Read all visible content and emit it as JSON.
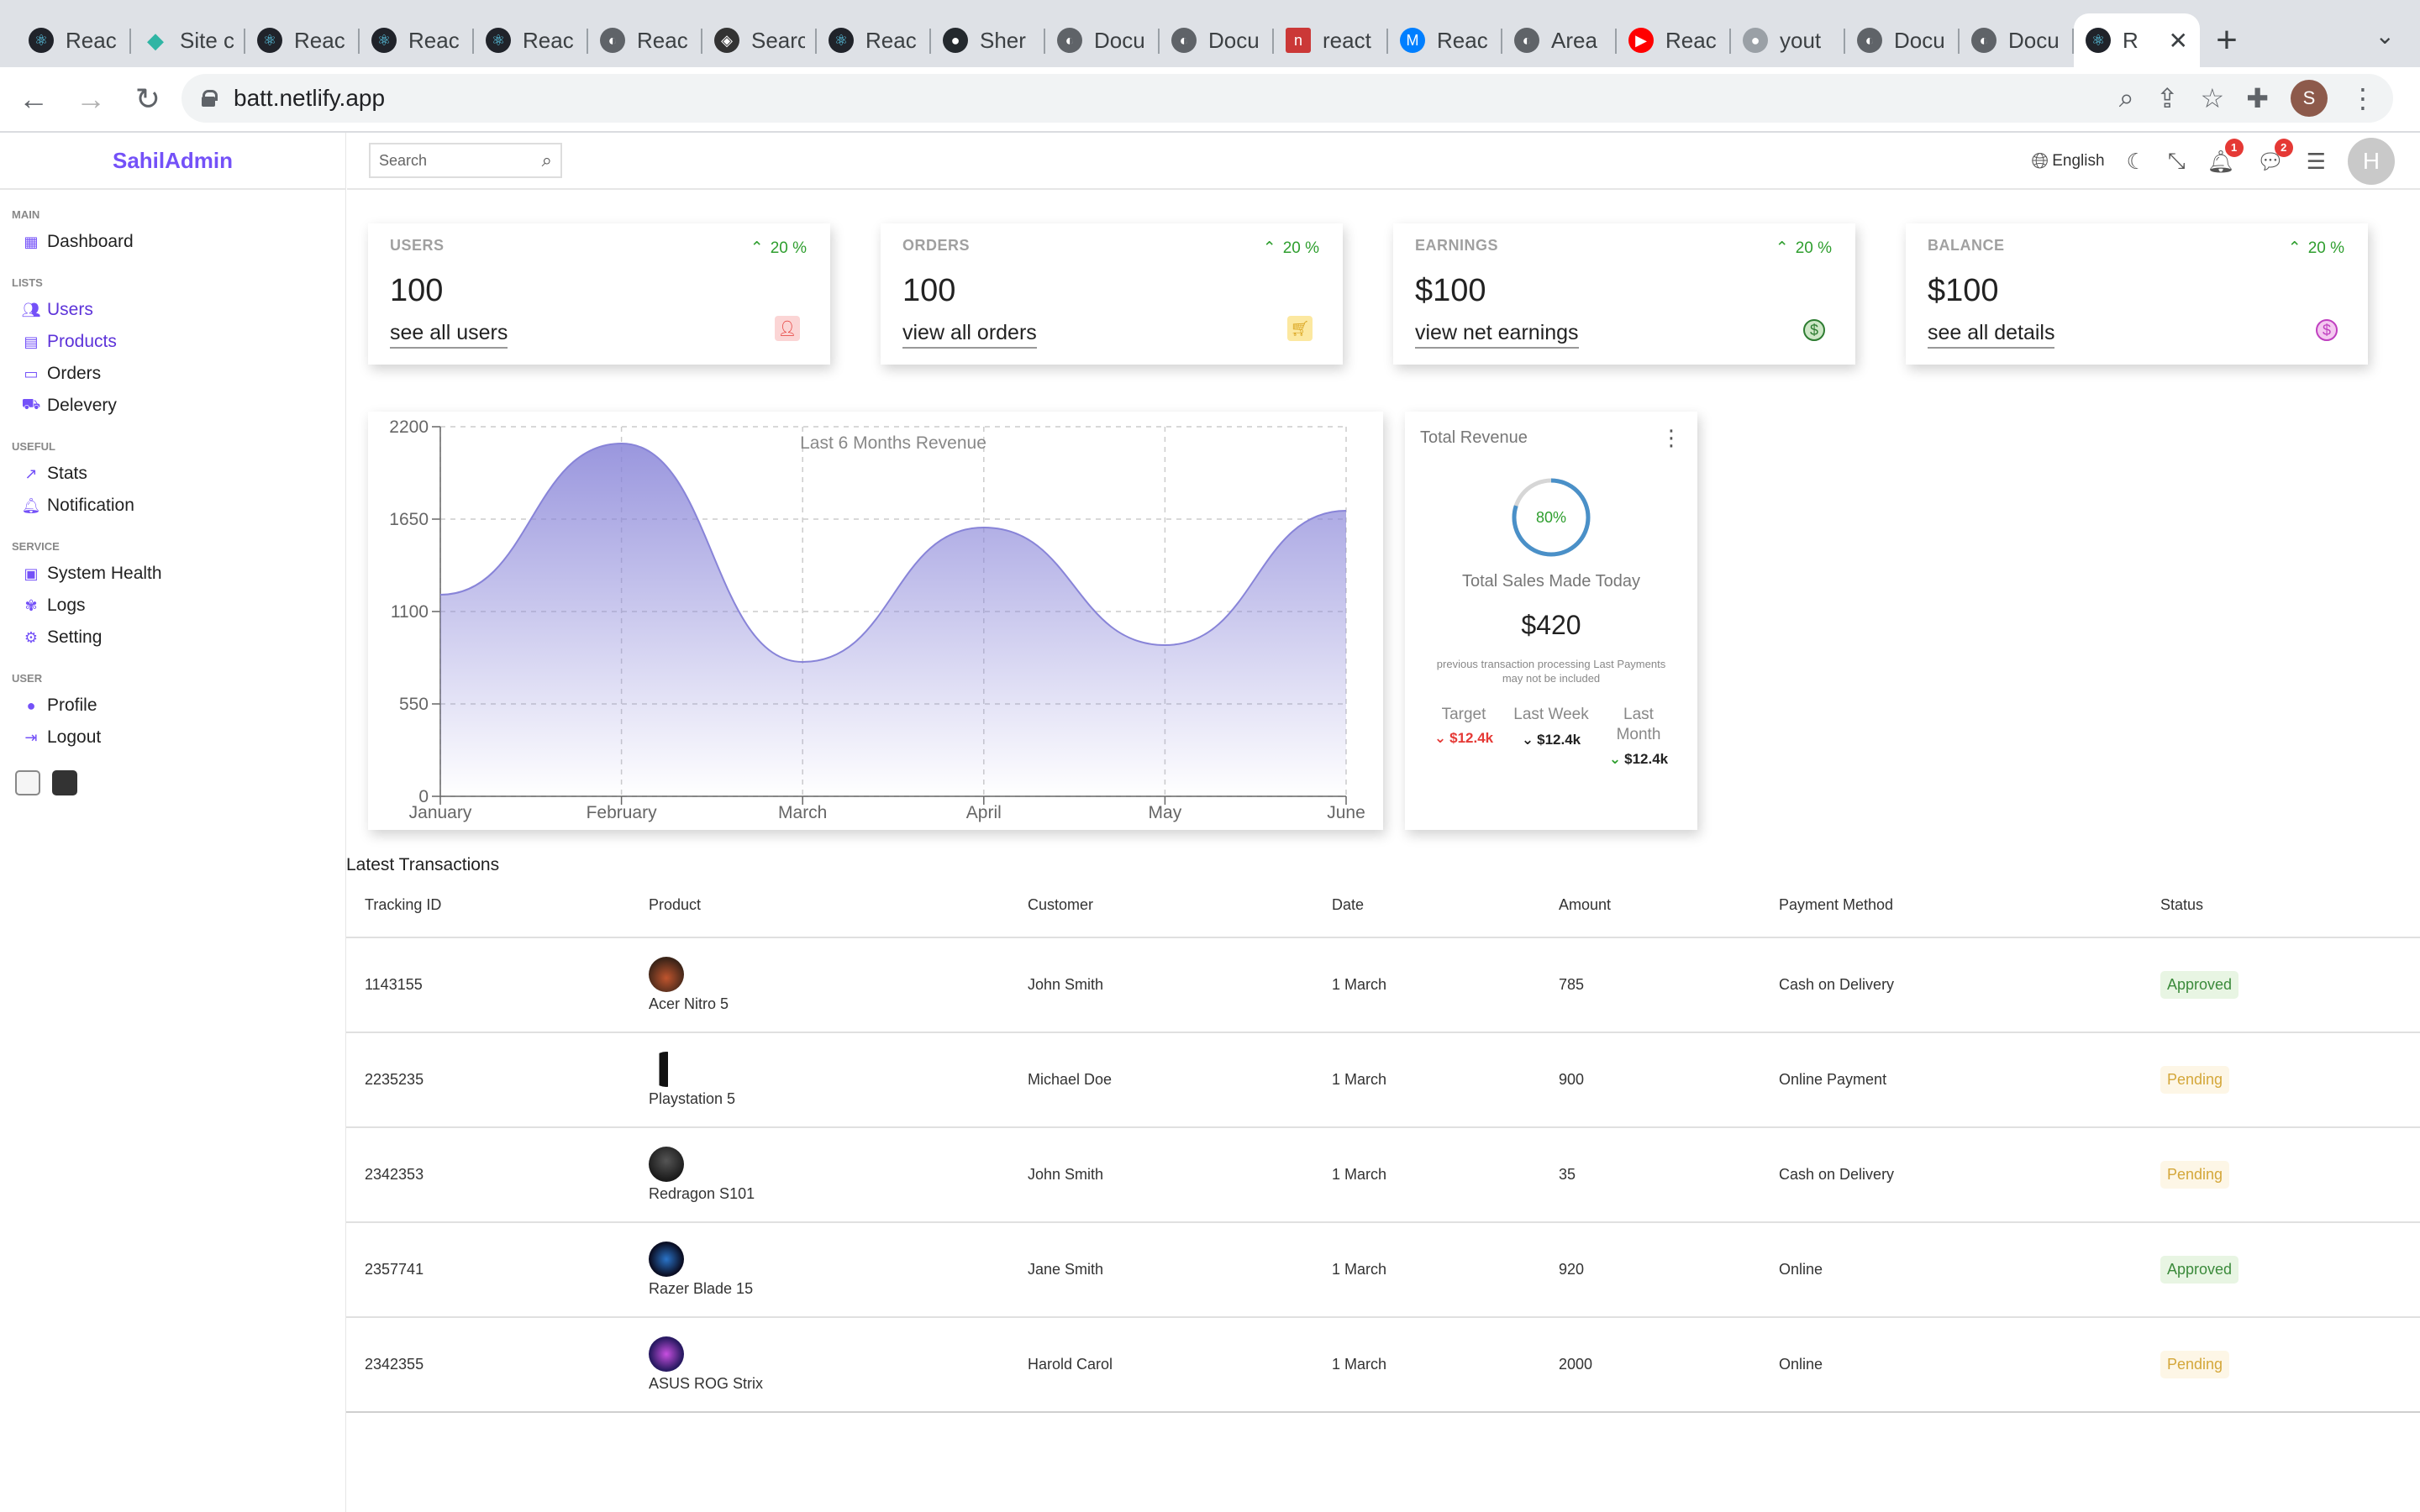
{
  "browser": {
    "tabs": [
      {
        "label": "Reac",
        "icon": "react-icon",
        "color": "#61dafb"
      },
      {
        "label": "Site c",
        "icon": "netlify-icon",
        "color": "#2fb5a4"
      },
      {
        "label": "Reac",
        "icon": "react-icon",
        "color": "#61dafb"
      },
      {
        "label": "Reac",
        "icon": "react-icon",
        "color": "#61dafb"
      },
      {
        "label": "Reac",
        "icon": "react-icon",
        "color": "#61dafb"
      },
      {
        "label": "Reac",
        "icon": "globe-icon",
        "color": "#5f6368"
      },
      {
        "label": "Searc",
        "icon": "git-icon",
        "color": "#333333"
      },
      {
        "label": "Reac",
        "icon": "react-icon",
        "color": "#61dafb"
      },
      {
        "label": "Sher",
        "icon": "github-icon",
        "color": "#24292e"
      },
      {
        "label": "Docu",
        "icon": "globe-icon",
        "color": "#5f6368"
      },
      {
        "label": "Docu",
        "icon": "globe-icon",
        "color": "#5f6368"
      },
      {
        "label": "react",
        "icon": "npm-icon",
        "color": "#cb3837"
      },
      {
        "label": "Reac",
        "icon": "mui-icon",
        "color": "#007fff"
      },
      {
        "label": "Area",
        "icon": "globe-icon",
        "color": "#5f6368"
      },
      {
        "label": "Reac",
        "icon": "youtube-icon",
        "color": "#ff0000"
      },
      {
        "label": "yout",
        "icon": "github-icon",
        "color": "#9aa0a6"
      },
      {
        "label": "Docu",
        "icon": "globe-icon",
        "color": "#5f6368"
      },
      {
        "label": "Docu",
        "icon": "globe-icon",
        "color": "#5f6368"
      }
    ],
    "active_tab": {
      "label": "R",
      "icon": "react-icon"
    },
    "url": "batt.netlify.app",
    "profile_initial": "S"
  },
  "sidebar": {
    "logo": "SahilAdmin",
    "sections": [
      {
        "title": "MAIN",
        "items": [
          {
            "label": "Dashboard",
            "icon": "dashboard-icon"
          }
        ]
      },
      {
        "title": "LISTS",
        "items": [
          {
            "label": "Users",
            "icon": "users-icon"
          },
          {
            "label": "Products",
            "icon": "store-icon"
          },
          {
            "label": "Orders",
            "icon": "orders-icon"
          },
          {
            "label": "Delevery",
            "icon": "truck-icon"
          }
        ]
      },
      {
        "title": "USEFUL",
        "items": [
          {
            "label": "Stats",
            "icon": "stats-icon"
          },
          {
            "label": "Notification",
            "icon": "bell-icon"
          }
        ]
      },
      {
        "title": "SERVICE",
        "items": [
          {
            "label": "System Health",
            "icon": "health-icon"
          },
          {
            "label": "Logs",
            "icon": "logs-icon"
          },
          {
            "label": "Setting",
            "icon": "settings-icon"
          }
        ]
      },
      {
        "title": "USER",
        "items": [
          {
            "label": "Profile",
            "icon": "profile-icon"
          },
          {
            "label": "Logout",
            "icon": "logout-icon"
          }
        ]
      }
    ]
  },
  "topbar": {
    "search_placeholder": "Search",
    "language": "English",
    "notifications_count": "1",
    "messages_count": "2",
    "avatar_initial": "H"
  },
  "widgets": [
    {
      "title": "USERS",
      "percentage": "20 %",
      "counter": "100",
      "link": "see all users",
      "icon": "person-icon",
      "icon_color": "#e53935",
      "icon_bg": "#fbd5d5"
    },
    {
      "title": "ORDERS",
      "percentage": "20 %",
      "counter": "100",
      "link": "view all orders",
      "icon": "cart-icon",
      "icon_color": "#daa520",
      "icon_bg": "#fce8a0"
    },
    {
      "title": "EARNINGS",
      "percentage": "20 %",
      "counter": "$100",
      "link": "view net earnings",
      "icon": "dollar-icon",
      "icon_color": "#2e7d32",
      "icon_bg": "#cde7c6"
    },
    {
      "title": "BALANCE",
      "percentage": "20 %",
      "counter": "$100",
      "link": "see all details",
      "icon": "wallet-icon",
      "icon_color": "#c040c0",
      "icon_bg": "#f4c8f0"
    }
  ],
  "chart_data": {
    "type": "area",
    "title": "Last 6 Months Revenue",
    "categories": [
      "January",
      "February",
      "March",
      "April",
      "May",
      "June"
    ],
    "values": [
      1200,
      2100,
      800,
      1600,
      900,
      1700
    ],
    "ylim": [
      0,
      2200
    ],
    "yticks": [
      "0",
      "550",
      "1100",
      "1650",
      "2200"
    ],
    "grid": true,
    "color": "#8884d8"
  },
  "featured": {
    "title": "Total Revenue",
    "progress": 80,
    "progress_label": "80%",
    "subtitle": "Total Sales Made Today",
    "amount": "$420",
    "description": "previous transaction processing Last Payments may not be included",
    "summary": [
      {
        "title": "Target",
        "value": "$12.4k",
        "trend": "down"
      },
      {
        "title": "Last Week",
        "value": "$12.4k",
        "trend": "down"
      },
      {
        "title": "Last Month",
        "value": "$12.4k",
        "trend": "up"
      }
    ]
  },
  "transactions": {
    "title": "Latest Transactions",
    "headers": [
      "Tracking ID",
      "Product",
      "Customer",
      "Date",
      "Amount",
      "Payment Method",
      "Status"
    ],
    "rows": [
      {
        "id": "1143155",
        "product": "Acer Nitro 5",
        "customer": "John Smith",
        "date": "1 March",
        "amount": "785",
        "method": "Cash on Delivery",
        "status": "Approved"
      },
      {
        "id": "2235235",
        "product": "Playstation 5",
        "customer": "Michael Doe",
        "date": "1 March",
        "amount": "900",
        "method": "Online Payment",
        "status": "Pending"
      },
      {
        "id": "2342353",
        "product": "Redragon S101",
        "customer": "John Smith",
        "date": "1 March",
        "amount": "35",
        "method": "Cash on Delivery",
        "status": "Pending"
      },
      {
        "id": "2357741",
        "product": "Razer Blade 15",
        "customer": "Jane Smith",
        "date": "1 March",
        "amount": "920",
        "method": "Online",
        "status": "Approved"
      },
      {
        "id": "2342355",
        "product": "ASUS ROG Strix",
        "customer": "Harold Carol",
        "date": "1 March",
        "amount": "2000",
        "method": "Online",
        "status": "Pending"
      }
    ]
  }
}
